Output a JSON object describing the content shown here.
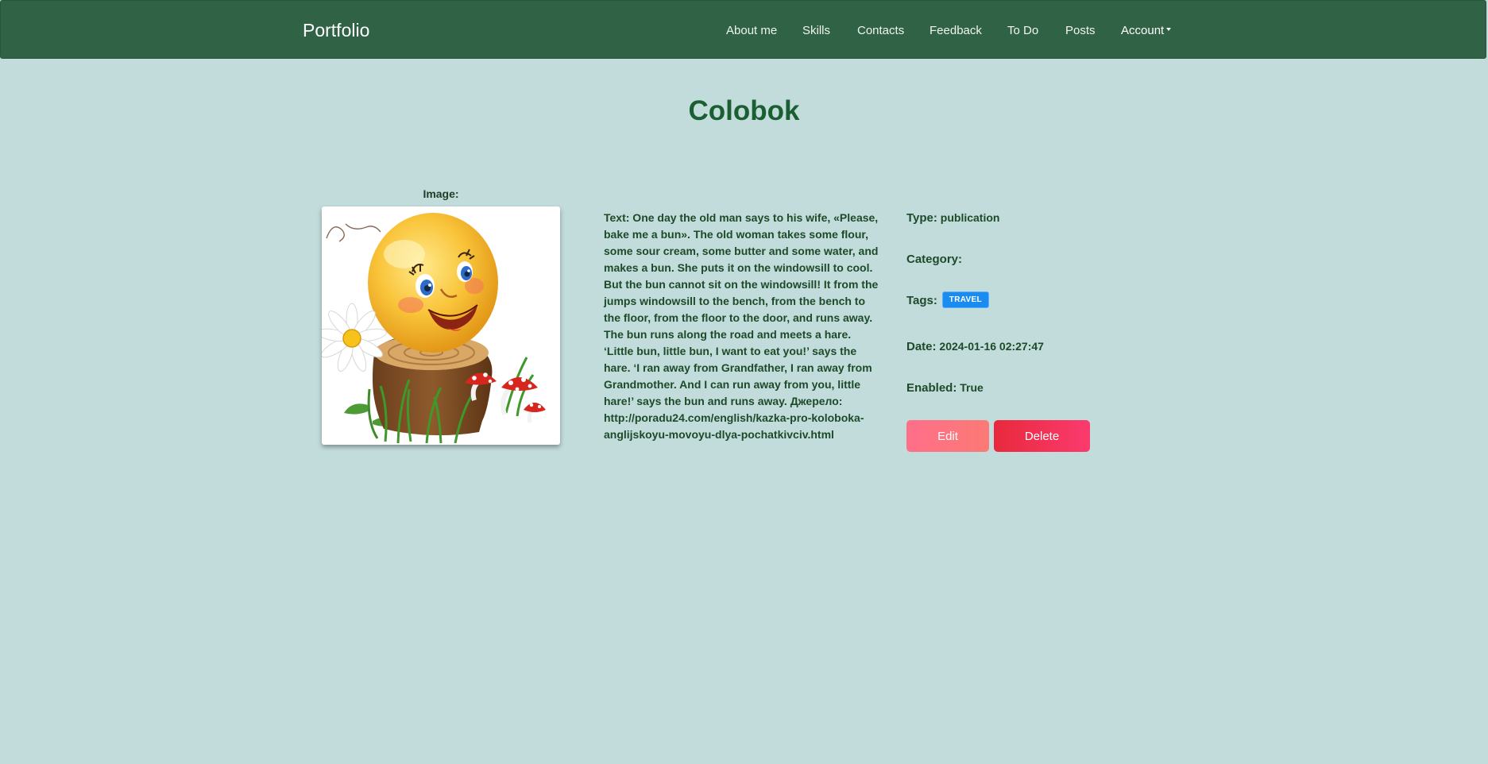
{
  "navbar": {
    "brand": "Portfolio",
    "links": [
      "About me",
      "Skills",
      "Contacts",
      "Feedback",
      "To Do",
      "Posts"
    ],
    "account_label": "Account"
  },
  "post": {
    "title": "Colobok",
    "image_label": "Image:",
    "text": "Text: One day the old man says to his wife, «Please, bake me a bun». The old woman takes some flour, some sour cream, some butter and some water, and makes a bun. She puts it on the windowsill to cool. But the bun cannot sit on the windowsill! It from the jumps windowsill to the bench, from the bench to the floor, from the floor to the door, and runs away. The bun runs along the road and meets a hare. ‘Little bun, little bun, I want to eat you!’ says the hare. ‘I ran away from Grandfather, I ran away from Grandmother. And I can run away from you, little hare!’ says the bun and runs away. Джерело: http://poradu24.com/english/kazka-pro-koloboka-anglijskoyu-movoyu-dlya-pochatkivciv.html",
    "meta": {
      "type_label": "Type:",
      "type_value": "publication",
      "category_label": "Category:",
      "category_value": "",
      "tags_label": "Tags:",
      "tags": [
        "TRAVEL"
      ],
      "date_label": "Date:",
      "date_value": "2024-01-16 02:27:47",
      "enabled_label": "Enabled:",
      "enabled_value": "True"
    },
    "actions": {
      "edit_label": "Edit",
      "delete_label": "Delete"
    }
  },
  "colors": {
    "navbar_bg": "#306246",
    "page_bg": "#c2dcdc",
    "title": "#1b5e32",
    "tag_badge": "#1a8cf0",
    "edit_button": "#ff6f8a",
    "delete_button": "#e8293c"
  },
  "icons": {
    "account_caret": "caret-down-icon",
    "post_image": "smiling-bun-illustration"
  }
}
